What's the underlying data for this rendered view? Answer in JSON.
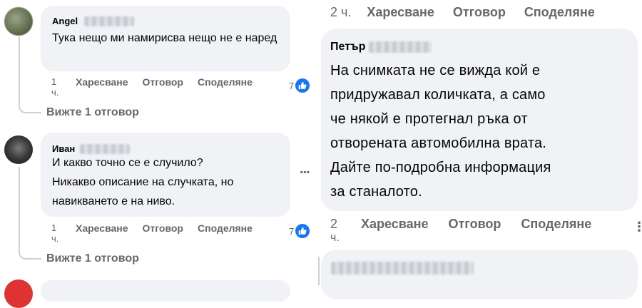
{
  "left": {
    "comment1": {
      "author": "Angel",
      "text": "Тука нещо ми намирисва нещо не е наред",
      "time_num": "1",
      "time_unit": "ч.",
      "like": "Харесване",
      "reply": "Отговор",
      "share": "Споделяне",
      "likes": "7",
      "see_replies": "Вижте 1 отговор"
    },
    "comment2": {
      "author": "Иван",
      "text_line1": "И какво точно се е случило?",
      "text_line2": "Никакво описание на случката, но",
      "text_line3": "навикването е на ниво.",
      "time_num": "1",
      "time_unit": "ч.",
      "like": "Харесване",
      "reply": "Отговор",
      "share": "Споделяне",
      "likes": "7",
      "see_replies": "Вижте 1 отговор",
      "more": "..."
    }
  },
  "right": {
    "top_actions": {
      "time": "2 ч.",
      "like": "Харесване",
      "reply": "Отговор",
      "share": "Споделяне"
    },
    "comment": {
      "author": "Петър",
      "lines": [
        "На снимката не се вижда кой е",
        "придружавал количката, а само",
        "че някой е протегнал ръка от",
        "отворената автомобилна врата.",
        "Дайте по-подробна информация",
        "за станалото."
      ],
      "time_num": "2",
      "time_unit": "ч.",
      "like": "Харесване",
      "reply": "Отговор",
      "share": "Споделяне",
      "more": "⋮"
    }
  },
  "colors": {
    "bubble": "#f0f2f5",
    "secondary_text": "#65676b",
    "like_blue": "#1877f2"
  },
  "icons": [
    "like-thumb-icon",
    "more-dots-icon"
  ]
}
